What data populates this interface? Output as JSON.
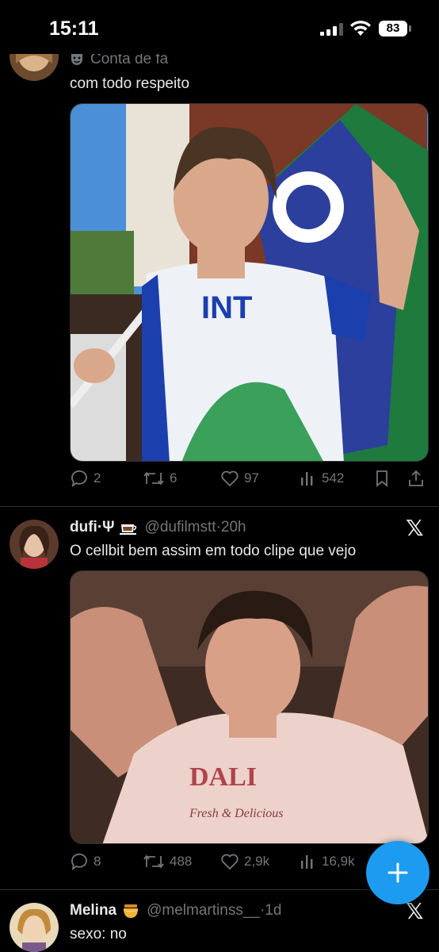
{
  "status_bar": {
    "time": "15:11",
    "battery": "83"
  },
  "tweets": [
    {
      "context_label": "Conta de fã",
      "text": "com todo respeito",
      "stats": {
        "replies": "2",
        "reposts": "6",
        "likes": "97",
        "views": "542"
      }
    },
    {
      "name": "dufi·Ψ",
      "handle": "@dufilmstt",
      "time": "20h",
      "text": "O cellbit bem assim em todo clipe que vejo",
      "stats": {
        "replies": "8",
        "reposts": "488",
        "likes": "2,9k",
        "views": "16,9k"
      }
    },
    {
      "name": "Melina",
      "handle": "@melmartinss__",
      "time": "1d",
      "text": "sexo: no"
    }
  ],
  "icons": {
    "masks": "masks-icon",
    "x_logo": "x-logo-icon",
    "reply": "reply-icon",
    "repost": "repost-icon",
    "like": "heart-icon",
    "views": "views-icon",
    "bookmark": "bookmark-icon",
    "share": "share-icon",
    "compose": "plus-icon"
  },
  "colors": {
    "accent": "#1d9bf0",
    "muted": "#71767b",
    "background": "#000000"
  }
}
